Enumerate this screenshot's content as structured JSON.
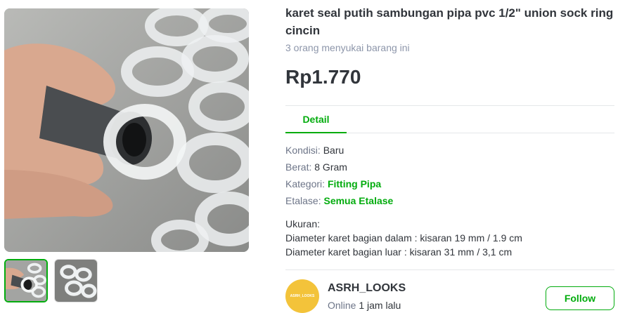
{
  "product": {
    "title": "karet seal putih sambungan pipa pvc 1/2\" union sock ring cincin",
    "likes": "3 orang menyukai barang ini",
    "price": "Rp1.770"
  },
  "tabs": [
    {
      "label": "Detail"
    }
  ],
  "details": {
    "kondisi": {
      "label": "Kondisi: ",
      "value": "Baru"
    },
    "berat": {
      "label": "Berat: ",
      "value": "8 Gram"
    },
    "kategori": {
      "label": "Kategori: ",
      "value": "Fitting Pipa"
    },
    "etalase": {
      "label": "Etalase: ",
      "value": "Semua Etalase"
    }
  },
  "description": [
    "Ukuran:",
    "Diameter karet bagian dalam : kisaran 19 mm / 1.9 cm",
    "Diameter karet bagian luar : kisaran 31 mm / 3,1 cm"
  ],
  "shop": {
    "name": "ASRH_LOOKS",
    "avatar_text": "ASRH_LOOKS",
    "status_prefix": "Online ",
    "status_time": "1 jam lalu",
    "follow_label": "Follow"
  },
  "colors": {
    "accent": "#03ac0e",
    "text": "#31353b",
    "muted": "#6d7588"
  },
  "icons": {
    "gallery": "product-photo"
  }
}
